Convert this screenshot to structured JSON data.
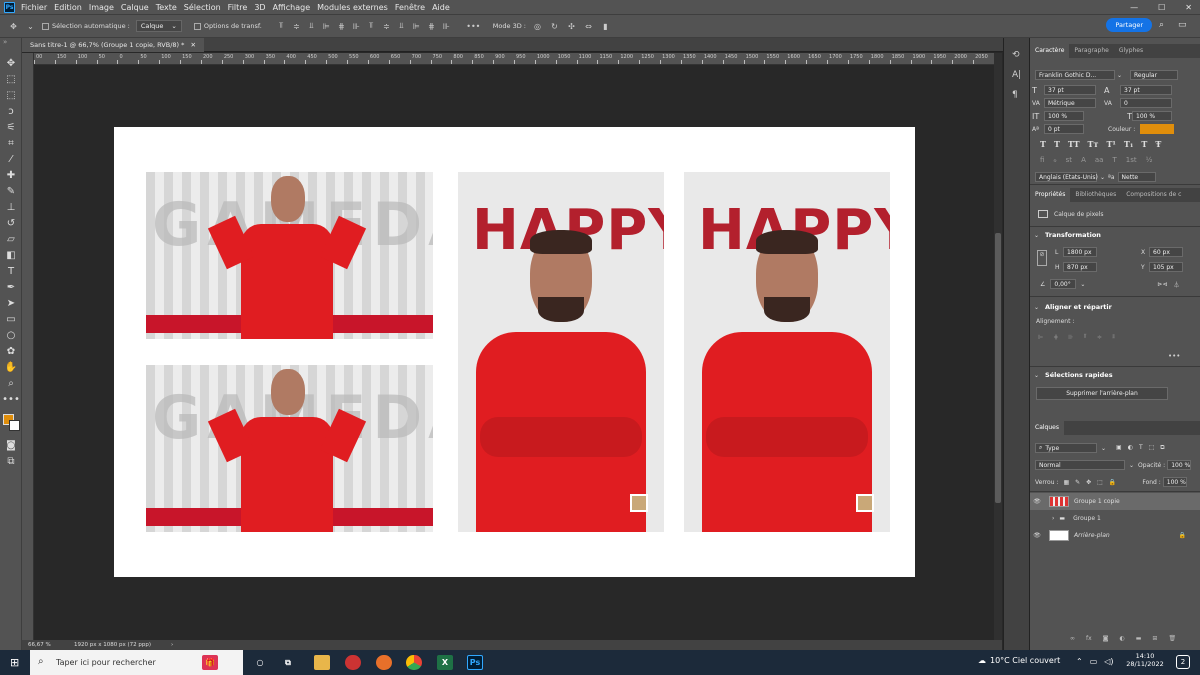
{
  "menubar": {
    "items": [
      "Fichier",
      "Edition",
      "Image",
      "Calque",
      "Texte",
      "Sélection",
      "Filtre",
      "3D",
      "Affichage",
      "Modules externes",
      "Fenêtre",
      "Aide"
    ],
    "window_controls": [
      "—",
      "☐",
      "✕"
    ]
  },
  "options": {
    "auto_select_label": "Sélection automatique :",
    "auto_select_value": "Calque",
    "transform_label": "Options de transf.",
    "mode3d_label": "Mode 3D :",
    "share_label": "Partager"
  },
  "document": {
    "tab_title": "Sans titre-1 @ 66,7% (Groupe 1 copie, RVB/8) *",
    "zoom": "66,67 %",
    "info": "1920 px x 1080 px (72 ppp)"
  },
  "ruler": {
    "labels": [
      "00",
      "150",
      "100",
      "50",
      "0",
      "50",
      "100",
      "150",
      "200",
      "250",
      "300",
      "350",
      "400",
      "450",
      "500",
      "550",
      "600",
      "650",
      "700",
      "750",
      "800",
      "850",
      "900",
      "950",
      "1000",
      "1050",
      "1100",
      "1150",
      "1200",
      "1250",
      "1300",
      "1350",
      "1400",
      "1450",
      "1500",
      "1550",
      "1600",
      "1650",
      "1700",
      "1750",
      "1800",
      "1850",
      "1900",
      "1950",
      "2000",
      "2050"
    ]
  },
  "artwork": {
    "happy_text": "HAPPY",
    "gray_text": "GAMEDAY"
  },
  "character": {
    "tabs": [
      "Caractère",
      "Paragraphe",
      "Glyphes"
    ],
    "font_family": "Franklin Gothic D...",
    "font_style": "Regular",
    "size": "37 pt",
    "leading": "37 pt",
    "kerning": "Métrique",
    "tracking": "0",
    "vscale": "100 %",
    "hscale": "100 %",
    "baseline": "0 pt",
    "color_label": "Couleur :",
    "color": "#e08e0b",
    "language": "Anglais (Etats-Unis)",
    "aa_icon": "ªa",
    "antialias": "Nette"
  },
  "properties": {
    "tabs": [
      "Propriétés",
      "Bibliothèques",
      "Compositions de c"
    ],
    "kind": "Calque de pixels",
    "transform_title": "Transformation",
    "w_label": "L",
    "w": "1800 px",
    "x_label": "X",
    "x": "60 px",
    "h_label": "H",
    "h": "870 px",
    "y_label": "Y",
    "y": "105 px",
    "angle": "0,00°",
    "align_title": "Aligner et répartir",
    "align_label": "Alignement :",
    "quick_title": "Sélections rapides",
    "remove_bg": "Supprimer l'arrière-plan"
  },
  "layers": {
    "title": "Calques",
    "filter": "Type",
    "blend": "Normal",
    "opacity_label": "Opacité :",
    "opacity": "100 %",
    "lock_label": "Verrou :",
    "fill_label": "Fond :",
    "fill": "100 %",
    "items": [
      {
        "name": "Groupe 1 copie"
      },
      {
        "name": "Groupe 1"
      },
      {
        "name": "Arrière-plan"
      }
    ]
  },
  "taskbar": {
    "search_placeholder": "Taper ici pour rechercher",
    "weather": "10°C  Ciel couvert",
    "time": "14:10",
    "date": "28/11/2022",
    "notif": "2",
    "excel_letter": "X",
    "ps_letter": "Ps"
  }
}
